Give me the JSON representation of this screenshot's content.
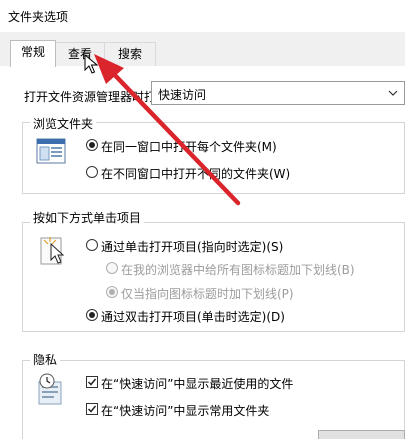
{
  "window": {
    "title": "文件夹选项"
  },
  "tabs": [
    {
      "label": "常规"
    },
    {
      "label": "查看"
    },
    {
      "label": "搜索"
    }
  ],
  "open_explorer": {
    "label": "打开文件资源管理器时打",
    "selected": "快速访问"
  },
  "browse_folders": {
    "title": "浏览文件夹",
    "options": [
      {
        "label": "在同一窗口中打开每个文件夹(M)"
      },
      {
        "label": "在不同窗口中打开不同的文件夹(W)"
      }
    ]
  },
  "click_items": {
    "title": "按如下方式单击项目",
    "options": [
      {
        "label": "通过单击打开项目(指向时选定)(S)"
      },
      {
        "label": "在我的浏览器中给所有图标标题加下划线(B)"
      },
      {
        "label": "仅当指向图标标题时加下划线(P)"
      },
      {
        "label": "通过双击打开项目(单击时选定)(D)"
      }
    ]
  },
  "privacy": {
    "title": "隐私",
    "options": [
      {
        "label": "在“快速访问”中显示最近使用的文件"
      },
      {
        "label": "在“快速访问”中显示常用文件夹"
      }
    ]
  },
  "colors": {
    "annotation_arrow": "#d9252b",
    "accent": "#0a64c8"
  }
}
